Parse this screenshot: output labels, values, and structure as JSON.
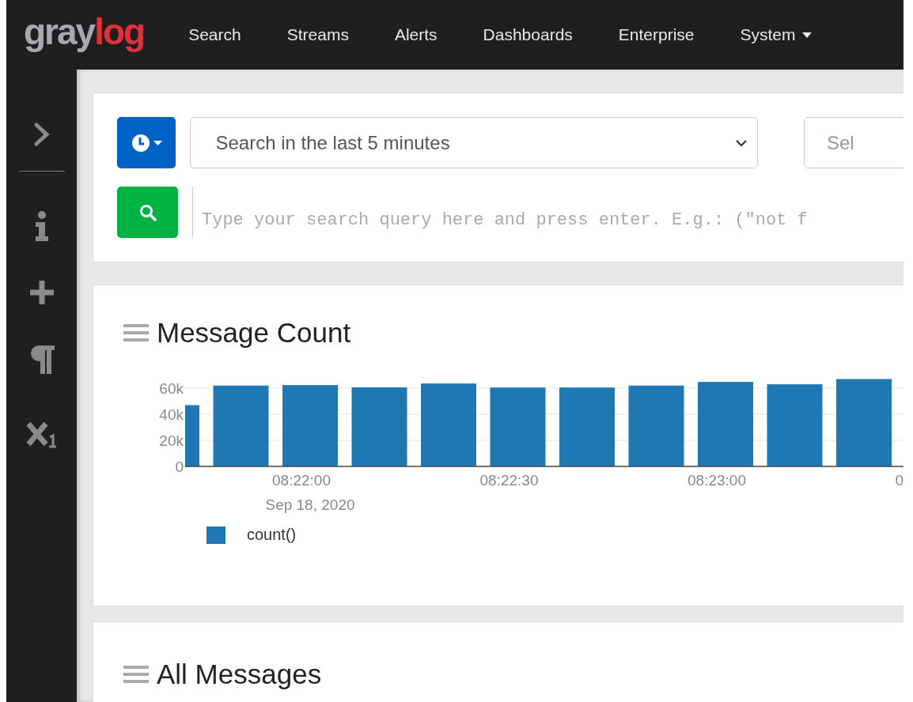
{
  "logo": {
    "primary": "gray",
    "accent": "log"
  },
  "nav": [
    {
      "label": "Search",
      "kind": "link"
    },
    {
      "label": "Streams",
      "kind": "link"
    },
    {
      "label": "Alerts",
      "kind": "link"
    },
    {
      "label": "Dashboards",
      "kind": "link"
    },
    {
      "label": "Enterprise",
      "kind": "link"
    },
    {
      "label": "System",
      "kind": "dropdown"
    }
  ],
  "sidebar": {
    "items": [
      {
        "kind": "expand"
      },
      {
        "kind": "divider"
      },
      {
        "kind": "info"
      },
      {
        "kind": "add"
      },
      {
        "kind": "paragraph"
      },
      {
        "kind": "subscript"
      }
    ]
  },
  "search_bar": {
    "time_range": "Search in the last 5 minutes",
    "streams_select": {
      "placeholder": "Sel"
    },
    "query": {
      "placeholder": "Type your search query here and press enter. E.g.: (\"not f"
    }
  },
  "message_count": {
    "title": "Message Count",
    "date_label": "Sep 18, 2020",
    "chart_data": {
      "type": "bar",
      "grid": true,
      "categories": [
        null,
        null,
        "08:22:00",
        null,
        null,
        "08:22:30",
        null,
        null,
        "08:23:00",
        null,
        null,
        "0"
      ],
      "ylim": [
        0,
        67000
      ],
      "series": [
        {
          "name": "count()",
          "color": "#1f77b4",
          "values": [
            47000,
            62000,
            62400,
            60600,
            63600,
            60500,
            60500,
            62000,
            64800,
            63000,
            67000,
            null
          ]
        }
      ],
      "yticks": [
        {
          "value": 0,
          "label": "0"
        },
        {
          "value": 20000,
          "label": "20k"
        },
        {
          "value": 40000,
          "label": "40k"
        },
        {
          "value": 60000,
          "label": "60k"
        }
      ]
    }
  },
  "all_messages": {
    "title": "All Messages"
  }
}
